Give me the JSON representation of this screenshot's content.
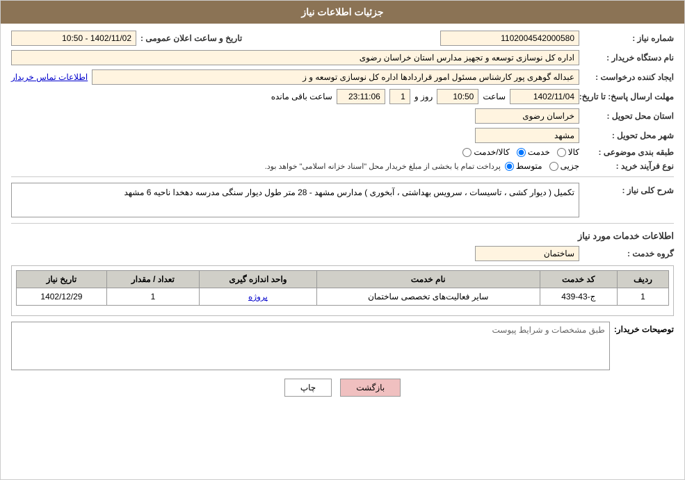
{
  "header": {
    "title": "جزئیات اطلاعات نیاز"
  },
  "fields": {
    "shomara_niaz_label": "شماره نیاز :",
    "shomara_niaz_value": "1102004542000580",
    "nam_dastgah_label": "نام دستگاه خریدار :",
    "nam_dastgah_value": "اداره کل نوسازی  توسعه و تجهیز مدارس استان خراسان رضوی",
    "ijad_konande_label": "ایجاد کننده درخواست :",
    "ijad_konande_value": "عبداله گوهری پور کارشناس مسئول امور قراردادها  اداره کل نوسازی  توسعه و ز",
    "ijad_konande_link": "اطلاعات تماس خریدار",
    "mohlet_label": "مهلت ارسال پاسخ: تا تاریخ:",
    "tarikh_value": "1402/11/04",
    "saet_label": "ساعت",
    "saet_value": "10:50",
    "rooz_label": "روز و",
    "rooz_value": "1",
    "maande_label": "ساعت باقی مانده",
    "maande_value": "23:11:06",
    "ostan_label": "استان محل تحویل :",
    "ostan_value": "خراسان رضوی",
    "shahr_label": "شهر محل تحویل :",
    "shahr_value": "مشهد",
    "tabagheh_label": "طبقه بندی موضوعی :",
    "radio_kala": "کالا",
    "radio_khadamat": "خدمت",
    "radio_kala_khadamat": "کالا/خدمت",
    "radio_selected": "khadamat",
    "faraaind_label": "نوع فرآیند خرید :",
    "radio_jozii": "جزیی",
    "radio_matawaset": "متوسط",
    "faraaind_text": "پرداخت تمام یا بخشی از مبلغ خریدار محل \"اسناد خزانه اسلامی\" خواهد بود.",
    "radio_faraaind_selected": "matawaset",
    "sharh_label": "شرح کلی نیاز :",
    "sharh_value": "تکمیل ( دیوار کشی ، تاسیسات ، سرویس بهداشتی ، آبخوری ) مدارس مشهد - 28 متر طول دیوار سنگی مدرسه دهخدا ناحیه 6 مشهد",
    "khadamat_section": "اطلاعات خدمات مورد نیاز",
    "grooh_label": "گروه خدمت :",
    "grooh_value": "ساختمان",
    "table": {
      "headers": [
        "ردیف",
        "کد خدمت",
        "نام خدمت",
        "واحد اندازه گیری",
        "تعداد / مقدار",
        "تاریخ نیاز"
      ],
      "rows": [
        {
          "radif": "1",
          "kod": "ج-43-439",
          "naam": "سایر فعالیت‌های تخصصی ساختمان",
          "vahed": "پروژه",
          "tedad": "1",
          "tarikh": "1402/12/29"
        }
      ]
    },
    "tawsif_label": "توصیحات خریدار:",
    "tawsif_value": "طبق مشخصات و شرایط پیوست"
  },
  "buttons": {
    "print": "چاپ",
    "back": "بازگشت"
  },
  "colors": {
    "header_bg": "#8B7355",
    "table_header_bg": "#d0cfc8"
  }
}
